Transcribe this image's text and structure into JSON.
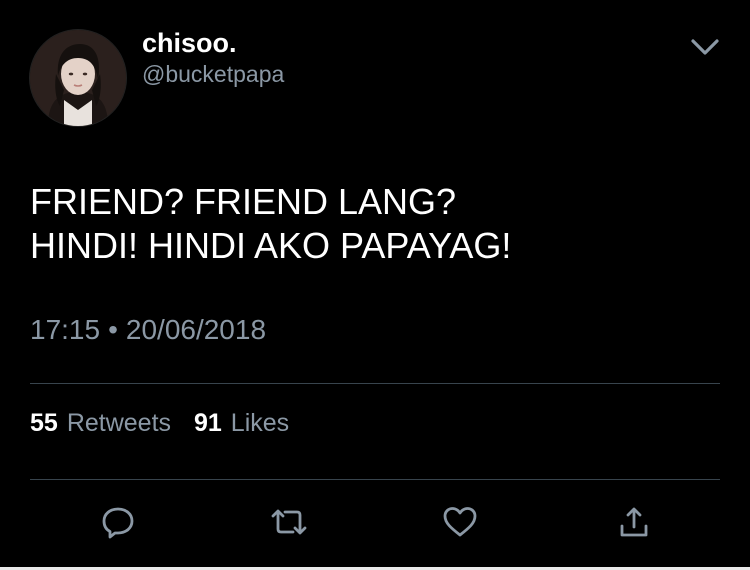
{
  "tweet": {
    "author": {
      "display_name": "chisoo.",
      "handle": "@bucketpapa"
    },
    "text_lines": [
      "FRIEND? FRIEND LANG?",
      "HINDI! HINDI AKO PAPAYAG!"
    ],
    "time": "17:15",
    "separator": "•",
    "date": "20/06/2018",
    "stats": {
      "retweets_count": "55",
      "retweets_label": "Retweets",
      "likes_count": "91",
      "likes_label": "Likes"
    },
    "actions": {
      "reply_icon": "reply-icon",
      "retweet_icon": "retweet-icon",
      "like_icon": "heart-icon",
      "share_icon": "share-icon"
    }
  },
  "colors": {
    "background": "#000000",
    "primary_text": "#ffffff",
    "secondary_text": "#8b98a5",
    "divider": "#38444d",
    "icon": "#8b98a5"
  }
}
